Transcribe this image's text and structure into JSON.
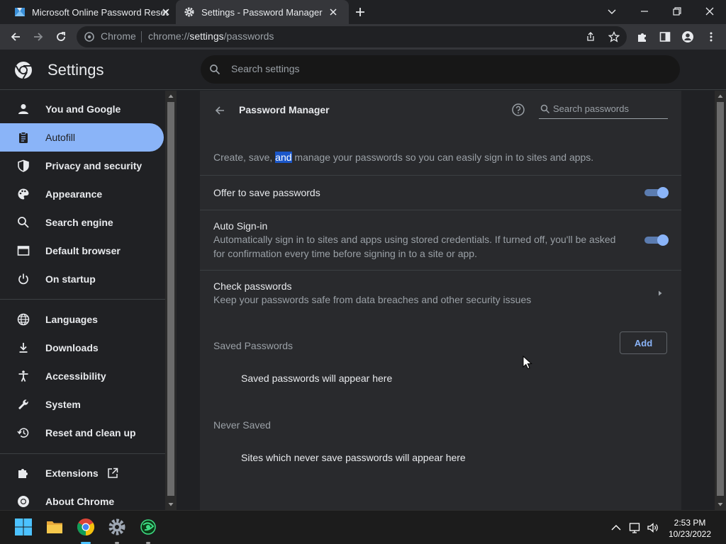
{
  "tabs": [
    {
      "title": "Microsoft Online Password Reset",
      "active": false
    },
    {
      "title": "Settings - Password Manager",
      "active": true
    }
  ],
  "omnibox": {
    "site_chip": "Chrome",
    "url_scheme": "chrome://",
    "url_host": "settings",
    "url_path": "/passwords"
  },
  "settings_header": {
    "title": "Settings",
    "search_placeholder": "Search settings"
  },
  "sidebar": {
    "items": [
      {
        "label": "You and Google",
        "icon": "person-icon"
      },
      {
        "label": "Autofill",
        "icon": "clipboard-icon",
        "active": true
      },
      {
        "label": "Privacy and security",
        "icon": "shield-icon"
      },
      {
        "label": "Appearance",
        "icon": "palette-icon"
      },
      {
        "label": "Search engine",
        "icon": "search-icon"
      },
      {
        "label": "Default browser",
        "icon": "browser-icon"
      },
      {
        "label": "On startup",
        "icon": "power-icon"
      },
      {
        "label": "Languages",
        "icon": "globe-icon"
      },
      {
        "label": "Downloads",
        "icon": "download-icon"
      },
      {
        "label": "Accessibility",
        "icon": "accessibility-icon"
      },
      {
        "label": "System",
        "icon": "wrench-icon"
      },
      {
        "label": "Reset and clean up",
        "icon": "history-icon"
      },
      {
        "label": "Extensions",
        "icon": "puzzle-icon"
      },
      {
        "label": "About Chrome",
        "icon": "chrome-icon"
      }
    ]
  },
  "password_manager": {
    "title": "Password Manager",
    "search_placeholder": "Search passwords",
    "intro_before": "Create, save, ",
    "intro_selected": "and",
    "intro_after": " manage your passwords so you can easily sign in to sites and apps.",
    "offer_to_save": {
      "label": "Offer to save passwords",
      "enabled": true
    },
    "auto_signin": {
      "label": "Auto Sign-in",
      "description": "Automatically sign in to sites and apps using stored credentials. If turned off, you'll be asked for confirmation every time before signing in to a site or app.",
      "enabled": true
    },
    "check_passwords": {
      "label": "Check passwords",
      "description": "Keep your passwords safe from data breaches and other security issues"
    },
    "saved_passwords": {
      "heading": "Saved Passwords",
      "add_label": "Add",
      "empty_text": "Saved passwords will appear here"
    },
    "never_saved": {
      "heading": "Never Saved",
      "empty_text": "Sites which never save passwords will appear here"
    }
  },
  "taskbar": {
    "time": "2:53 PM",
    "date": "10/23/2022"
  },
  "colors": {
    "accent": "#8ab4f8",
    "background": "#202124",
    "card": "#292a2d",
    "selection": "#1a56c9"
  }
}
